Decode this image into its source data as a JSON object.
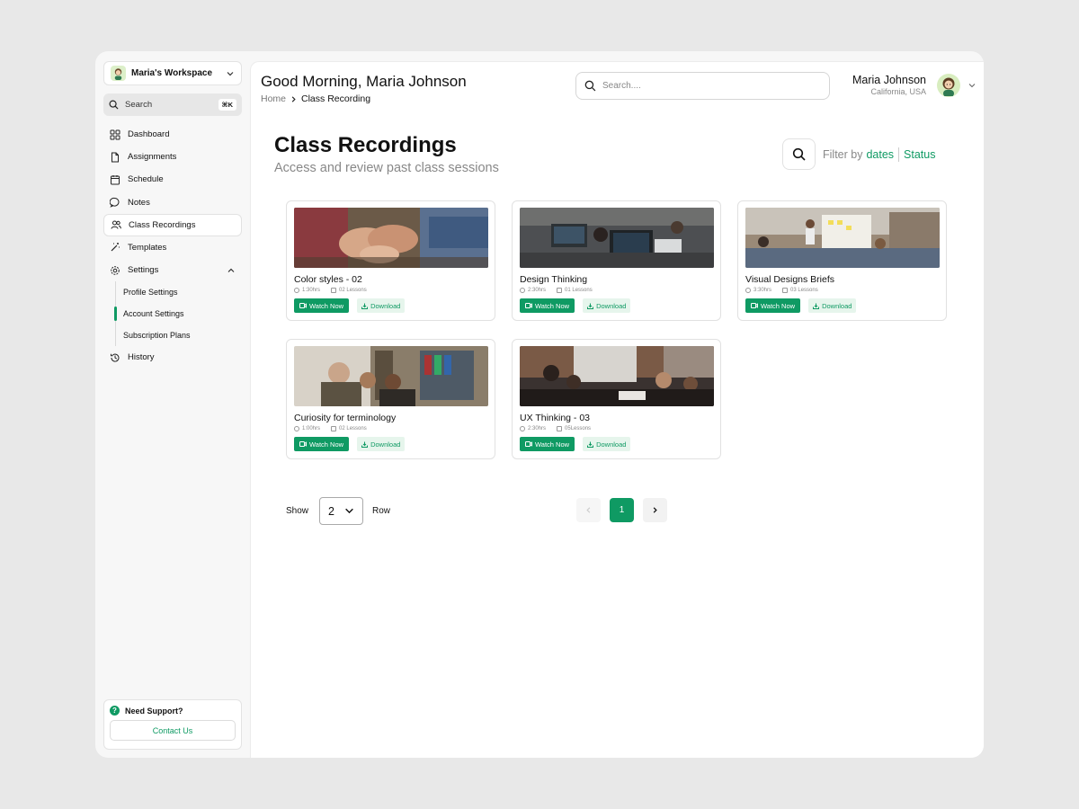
{
  "sidebar": {
    "workspace": "Maria's Workspace",
    "search_label": "Search",
    "search_shortcut": "⌘K",
    "items": [
      {
        "label": "Dashboard"
      },
      {
        "label": "Assignments"
      },
      {
        "label": "Schedule"
      },
      {
        "label": "Notes"
      },
      {
        "label": "Class Recordings"
      },
      {
        "label": "Templates"
      },
      {
        "label": "Settings"
      },
      {
        "label": "History"
      }
    ],
    "settings_sub": [
      {
        "label": "Profile Settings"
      },
      {
        "label": "Account Settings"
      },
      {
        "label": "Subscription Plans"
      }
    ],
    "support_title": "Need Support?",
    "contact_label": "Contact Us"
  },
  "header": {
    "greeting": "Good Morning, Maria Johnson",
    "breadcrumb_home": "Home",
    "breadcrumb_current": "Class Recording",
    "search_placeholder": "Search....",
    "user_name": "Maria Johnson",
    "user_location": "California, USA"
  },
  "page": {
    "title": "Class Recordings",
    "subtitle": "Access and review past class sessions",
    "filter_prefix": "Filter by",
    "filter_dates": "dates",
    "filter_status": "Status"
  },
  "cards": [
    {
      "title": "Color styles - 02",
      "duration": "1:30hrs",
      "lessons": "02 Lessons",
      "watch": "Watch Now",
      "download": "Download"
    },
    {
      "title": "Design Thinking",
      "duration": "2:30hrs",
      "lessons": "01 Lessons",
      "watch": "Watch Now",
      "download": "Download"
    },
    {
      "title": "Visual Designs Briefs",
      "duration": "3:30hrs",
      "lessons": "03 Lessons",
      "watch": "Watch Now",
      "download": "Download"
    },
    {
      "title": "Curiosity for terminology",
      "duration": "1:00hrs",
      "lessons": "02 Lessons",
      "watch": "Watch Now",
      "download": "Download"
    },
    {
      "title": "UX Thinking - 03",
      "duration": "2:30hrs",
      "lessons": "05Lessons",
      "watch": "Watch Now",
      "download": "Download"
    }
  ],
  "pagination": {
    "show_label": "Show",
    "rows_value": "2",
    "row_label": "Row",
    "current_page": "1"
  },
  "colors": {
    "accent": "#0f9a63",
    "accent_light": "#e6f5ec"
  }
}
